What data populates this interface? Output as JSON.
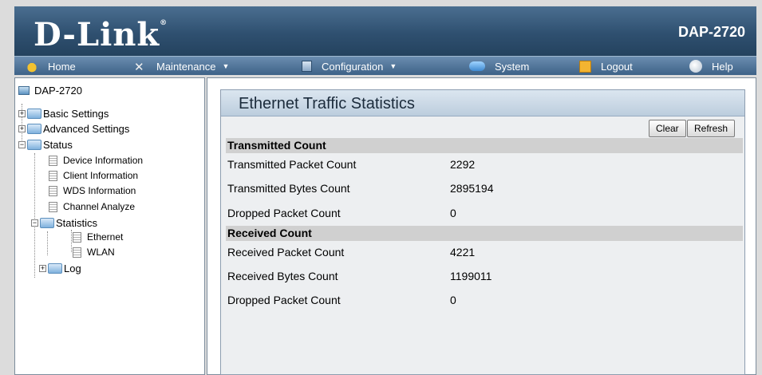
{
  "header": {
    "logo": "D-Link",
    "logo_mark": "®",
    "model": "DAP-2720"
  },
  "menu": {
    "home": "Home",
    "maintenance": "Maintenance",
    "configuration": "Configuration",
    "system": "System",
    "logout": "Logout",
    "help": "Help",
    "caret": "▼"
  },
  "sidebar": {
    "root": "DAP-2720",
    "basic_settings": "Basic Settings",
    "advanced_settings": "Advanced Settings",
    "status": "Status",
    "device_information": "Device Information",
    "client_information": "Client Information",
    "wds_information": "WDS Information",
    "channel_analyze": "Channel Analyze",
    "statistics": "Statistics",
    "ethernet": "Ethernet",
    "wlan": "WLAN",
    "log": "Log",
    "plus": "+",
    "minus": "−"
  },
  "panel": {
    "title": "Ethernet Traffic Statistics",
    "clear_label": "Clear",
    "refresh_label": "Refresh"
  },
  "transmitted": {
    "heading": "Transmitted Count",
    "rows": [
      {
        "label": "Transmitted Packet Count",
        "value": "2292"
      },
      {
        "label": "Transmitted Bytes Count",
        "value": "2895194"
      },
      {
        "label": "Dropped Packet Count",
        "value": "0"
      }
    ]
  },
  "received": {
    "heading": "Received Count",
    "rows": [
      {
        "label": "Received Packet Count",
        "value": "4221"
      },
      {
        "label": "Received Bytes Count",
        "value": "1199011"
      },
      {
        "label": "Dropped Packet Count",
        "value": "0"
      }
    ]
  },
  "colors": {
    "header_bg": "#2f5070",
    "menu_bg": "#4f739a",
    "section_bar": "#d0d0d0"
  }
}
